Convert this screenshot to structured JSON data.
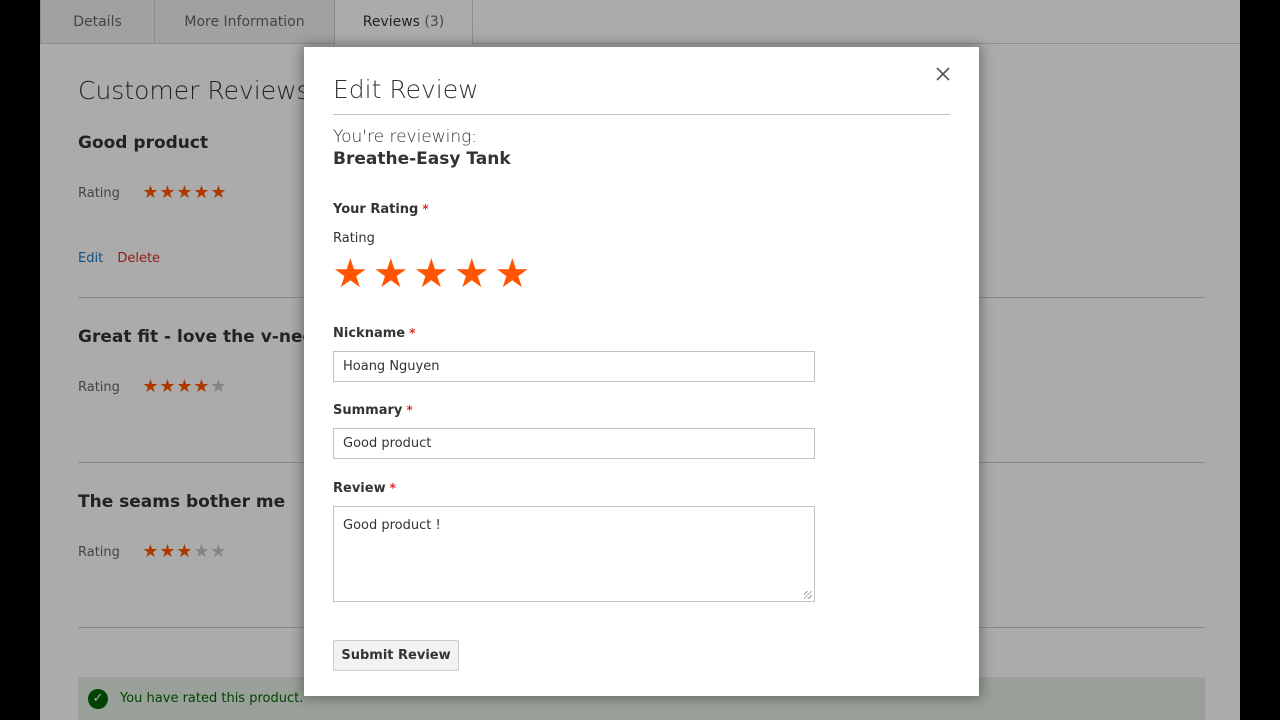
{
  "tabs": [
    {
      "label": "Details"
    },
    {
      "label": "More Information"
    },
    {
      "label": "Reviews",
      "count": "(3)"
    }
  ],
  "heading": "Customer Reviews",
  "rating_label": "Rating",
  "reviews": [
    {
      "title": "Good product",
      "rating": 5,
      "max": 5,
      "edit": "Edit",
      "delete": "Delete"
    },
    {
      "title": "Great fit - love the v-neck d",
      "rating": 4,
      "max": 5
    },
    {
      "title": "The seams bother me",
      "rating": 3,
      "max": 5
    }
  ],
  "message": "You have rated this product.",
  "modal": {
    "title": "Edit Review",
    "reviewing": "You're reviewing:",
    "product": "Breathe-Easy Tank",
    "your_rating_label": "Your Rating",
    "rating_sublabel": "Rating",
    "rating_value": 5,
    "rating_max": 5,
    "required_mark": "*",
    "nickname_label": "Nickname",
    "nickname_value": "Hoang Nguyen",
    "summary_label": "Summary",
    "summary_value": "Good product",
    "review_label": "Review",
    "review_value": "Good product !",
    "submit_label": "Submit Review"
  },
  "colors": {
    "star_on": "#ff5501",
    "star_off": "#c7c7c7",
    "edit_link": "#1979c3",
    "delete_link": "#e02b27",
    "success_text": "#006400"
  },
  "icons": {
    "close": "close-icon",
    "star": "star-icon",
    "check": "checkmark-circle-icon"
  }
}
